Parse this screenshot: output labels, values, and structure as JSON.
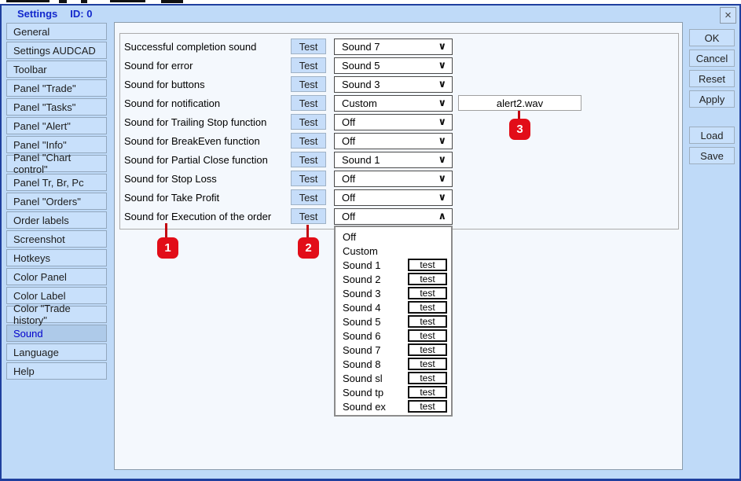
{
  "window": {
    "title": "Settings",
    "id_label": "ID: 0"
  },
  "icons": {
    "close": "×",
    "chevron_down": "∨",
    "chevron_up": "∧"
  },
  "sidebar": {
    "items": [
      {
        "label": "General"
      },
      {
        "label": "Settings AUDCAD"
      },
      {
        "label": "Toolbar"
      },
      {
        "label": "Panel \"Trade\""
      },
      {
        "label": "Panel \"Tasks\""
      },
      {
        "label": "Panel \"Alert\""
      },
      {
        "label": "Panel \"Info\""
      },
      {
        "label": "Panel \"Chart control\""
      },
      {
        "label": "Panel Tr, Br, Pc"
      },
      {
        "label": "Panel \"Orders\""
      },
      {
        "label": "Order labels"
      },
      {
        "label": "Screenshot"
      },
      {
        "label": "Hotkeys"
      },
      {
        "label": "Color Panel"
      },
      {
        "label": "Color Label"
      },
      {
        "label": "Color \"Trade history\""
      },
      {
        "label": "Sound",
        "selected": true
      },
      {
        "label": "Language"
      },
      {
        "label": "Help"
      }
    ]
  },
  "main": {
    "test_button_label": "Test",
    "rows": [
      {
        "label": "Successful completion sound",
        "value": "Sound 7"
      },
      {
        "label": "Sound for error",
        "value": "Sound 5"
      },
      {
        "label": "Sound for buttons",
        "value": "Sound 3"
      },
      {
        "label": "Sound for notification",
        "value": "Custom",
        "file": "alert2.wav"
      },
      {
        "label": "Sound for Trailing Stop function",
        "value": "Off"
      },
      {
        "label": "Sound for BreakEven function",
        "value": "Off"
      },
      {
        "label": "Sound for Partial Close function",
        "value": "Sound 1"
      },
      {
        "label": "Sound for Stop Loss",
        "value": "Off"
      },
      {
        "label": "Sound for Take Profit",
        "value": "Off"
      },
      {
        "label": "Sound for Execution of the order",
        "value": "Off",
        "open": true
      }
    ],
    "dropdown": {
      "test_button_label": "test",
      "items": [
        {
          "label": "Off"
        },
        {
          "label": "Custom"
        },
        {
          "label": "Sound 1",
          "has_test": true
        },
        {
          "label": "Sound 2",
          "has_test": true
        },
        {
          "label": "Sound 3",
          "has_test": true
        },
        {
          "label": "Sound 4",
          "has_test": true
        },
        {
          "label": "Sound 5",
          "has_test": true
        },
        {
          "label": "Sound 6",
          "has_test": true
        },
        {
          "label": "Sound 7",
          "has_test": true
        },
        {
          "label": "Sound 8",
          "has_test": true
        },
        {
          "label": "Sound sl",
          "has_test": true
        },
        {
          "label": "Sound tp",
          "has_test": true
        },
        {
          "label": "Sound ex",
          "has_test": true
        }
      ]
    }
  },
  "action_buttons": {
    "ok": "OK",
    "cancel": "Cancel",
    "reset": "Reset",
    "apply": "Apply",
    "load": "Load",
    "save": "Save"
  },
  "callouts": [
    {
      "number": "1"
    },
    {
      "number": "2"
    },
    {
      "number": "3"
    }
  ],
  "colors": {
    "dialog_bg": "#BFDAF8",
    "dialog_border": "#1F3F9E",
    "title_text": "#1228CC",
    "selected_item_bg": "#AECAE9",
    "selected_item_text": "#0000CC",
    "badge_red": "#E20D18"
  }
}
